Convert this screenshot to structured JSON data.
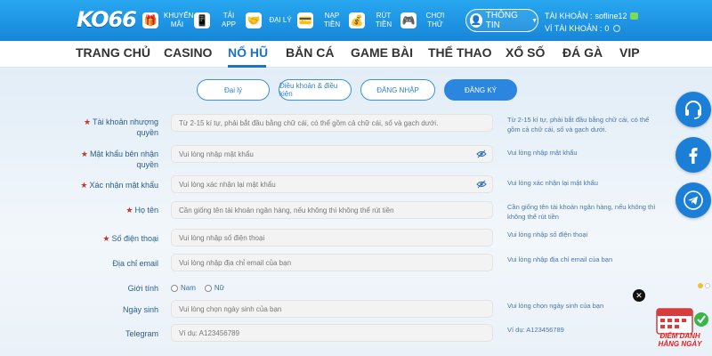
{
  "header": {
    "logo": "KO66",
    "nav_icons": [
      {
        "icon": "gift-icon",
        "glyph": "🎁",
        "label": "KHUYẾN MÃI"
      },
      {
        "icon": "phone-icon",
        "glyph": "📱",
        "label": "TẢI APP"
      },
      {
        "icon": "handshake-icon",
        "glyph": "🤝",
        "label": "ĐẠI LÝ"
      },
      {
        "icon": "wallet-icon",
        "glyph": "💳",
        "label": "NẠP TIỀN"
      },
      {
        "icon": "money-bag-icon",
        "glyph": "💰",
        "label": "RÚT TIỀN"
      },
      {
        "icon": "gamepad-icon",
        "glyph": "🎮",
        "label": "CHƠI THỬ"
      }
    ],
    "info_button": "THÔNG TIN",
    "account_label": "TÀI KHOẢN :",
    "account_value": "sofline12",
    "wallet_label": "VÍ TÀI KHOẢN :",
    "wallet_value": "0"
  },
  "mainnav": {
    "items": [
      "TRANG CHỦ",
      "CASINO",
      "NỔ HŨ",
      "BẮN CÁ",
      "GAME BÀI",
      "THỂ THAO",
      "XỔ SỐ",
      "ĐÁ GÀ",
      "VIP"
    ],
    "active": "NỔ HŨ"
  },
  "tabs": [
    "Đại lý",
    "Điều khoản & điều kiện",
    "ĐĂNG NHẬP",
    "ĐĂNG KÝ"
  ],
  "form": {
    "username": {
      "label": "Tài khoản nhượng quyền",
      "placeholder": "Từ 2-15 kí tự, phải bắt đầu bằng chữ cái, có thể  gồm cả chữ cái, số và gạch dưới.",
      "hint": "Từ 2-15 kí tự, phải bắt đầu bằng chữ cái, có thể gồm cả chữ cái, số và gạch dưới."
    },
    "password": {
      "label": "Mật khẩu bên nhận quyền",
      "placeholder": "Vui lòng nhập mật khẩu",
      "hint": "Vui lòng nhập mật khẩu"
    },
    "confirm": {
      "label": "Xác nhận mật khẩu",
      "placeholder": "Vui lòng xác nhận lại mật khẩu",
      "hint": "Vui lòng xác nhận lại mật khẩu"
    },
    "fullname": {
      "label": "Họ tên",
      "placeholder": "Cần giống tên tài khoản ngân hàng, nếu không thì không thể rút tiền",
      "hint": "Cần giống tên tài khoản ngân hàng, nếu không thì không thể rút tiền"
    },
    "phone": {
      "label": "Số điện thoại",
      "placeholder": "Vui lòng nhập số điện thoại",
      "hint": "Vui lòng nhập số điện thoại"
    },
    "email": {
      "label": "Địa chỉ email",
      "placeholder": "Vui lòng nhập địa chỉ email của bạn",
      "hint": "Vui lòng nhập địa chỉ email của bạn"
    },
    "gender": {
      "label": "Giới tính",
      "options": [
        "Nam",
        "Nữ"
      ]
    },
    "birthday": {
      "label": "Ngày sinh",
      "placeholder": "Vui lòng chọn ngày sinh của bạn",
      "hint": "Vui lòng chọn ngày sinh của bạn"
    },
    "telegram": {
      "label": "Telegram",
      "placeholder": "Ví dụ:   A123456789",
      "hint": "Ví dụ:   A123456789"
    }
  },
  "side": {
    "icons": [
      "headset-icon",
      "facebook-icon",
      "telegram-icon"
    ],
    "promo_text": "ĐIỂM DANH HẰNG NGÀY"
  },
  "colors": {
    "header": "#1786d8",
    "accent": "#2a86df",
    "active_nav": "#1e73c7",
    "required": "#c0392b"
  }
}
